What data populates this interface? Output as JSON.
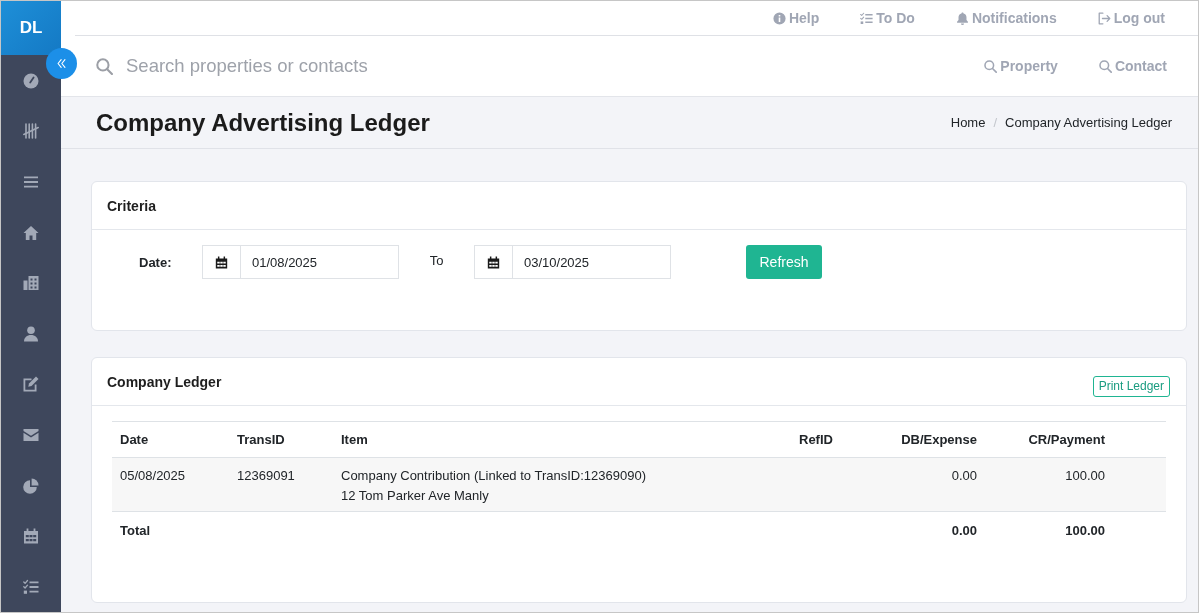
{
  "sidebar": {
    "logo": "DL"
  },
  "top_links": [
    "Help",
    "To Do",
    "Notifications",
    "Log out"
  ],
  "search": {
    "placeholder": "Search properties or contacts",
    "scopes": [
      "Property",
      "Contact"
    ]
  },
  "page_header": {
    "title": "Company Advertising Ledger",
    "breadcrumb": [
      "Home",
      "Company Advertising Ledger"
    ],
    "breadcrumb_separator": "/"
  },
  "criteria": {
    "title": "Criteria",
    "date_label": "Date:",
    "from_date": "01/08/2025",
    "to_label": "To",
    "to_date": "03/10/2025",
    "refresh_button": "Refresh"
  },
  "ledger": {
    "title": "Company Ledger",
    "print_button": "Print Ledger",
    "columns": [
      "Date",
      "TransID",
      "Item",
      "RefID",
      "DB/Expense",
      "CR/Payment"
    ],
    "rows": [
      {
        "date": "05/08/2025",
        "trans_id": "12369091",
        "item": [
          "Company Contribution (Linked to TransID:12369090)",
          "12 Tom Parker Ave Manly"
        ],
        "db_expense": "0.00",
        "cr_payment": "100.00"
      }
    ],
    "total": {
      "label": "Total",
      "db_expense": "0.00",
      "cr_payment": "100.00"
    }
  }
}
